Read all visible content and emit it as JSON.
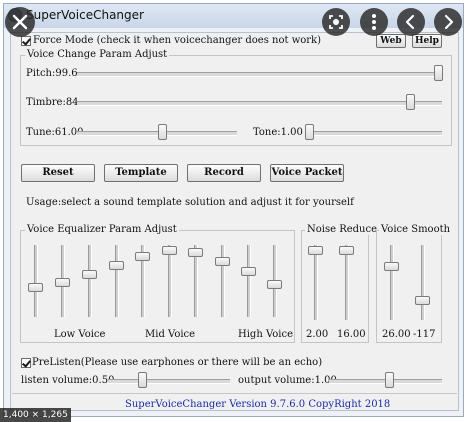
{
  "window": {
    "title": "SuperVoiceChanger"
  },
  "toolbar": {
    "force_mode_label": "Force Mode (check it when voicechanger does not work)",
    "force_mode_checked": true,
    "web_label": "Web",
    "help_label": "Help"
  },
  "param_adjust": {
    "group_title": "Voice Change Param Adjust",
    "pitch_label": "Pitch:99.6",
    "timbre_label": "Timbre:84.",
    "tune_label": "Tune:61.00",
    "tone_label": "Tone:1.00"
  },
  "actions": {
    "reset_label": "Reset",
    "template_label": "Template",
    "record_label": "Record",
    "voice_packet_label": "Voice Packet"
  },
  "usage_text": "Usage:select a sound template solution and adjust it for yourself",
  "equalizer": {
    "group_title": "Voice Equalizer Param Adjust",
    "low_label": "Low Voice",
    "mid_label": "Mid Voice",
    "high_label": "High Voice"
  },
  "noise_reduce": {
    "group_title": "Noise Reduce",
    "value_1": "2.00",
    "value_2": "16.00"
  },
  "voice_smooth": {
    "group_title": "Voice Smooth",
    "value_1": "26.00",
    "value_2": "-117"
  },
  "prelisten": {
    "label": "PreListen(Please use earphones or there will be an echo)",
    "checked": true,
    "listen_volume_label": "listen volume:0.50",
    "output_volume_label": "output volume:1.00"
  },
  "status_bar": {
    "text": "SuperVoiceChanger Version 9.7.6.0 CopyRight 2018"
  },
  "overlay": {
    "close_icon": "close-icon",
    "lens_icon": "lens-icon",
    "more_icon": "more-vert-icon",
    "prev_icon": "chevron-left-icon",
    "next_icon": "chevron-right-icon",
    "dimension_badge": "1,400 × 1,265"
  }
}
